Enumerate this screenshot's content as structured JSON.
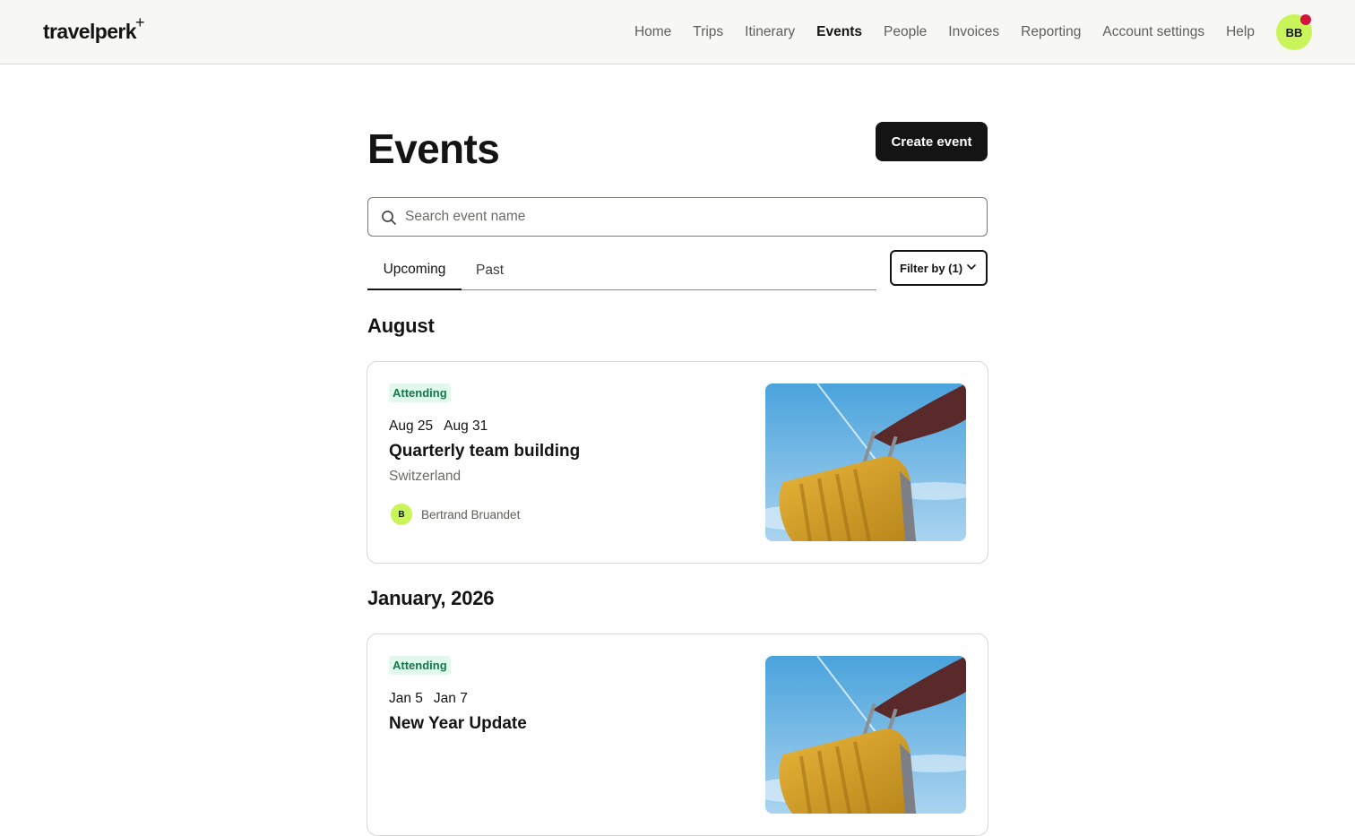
{
  "brand": {
    "logo_text": "travelperk",
    "logo_mark": "+"
  },
  "nav": {
    "items": [
      {
        "label": "Home",
        "active": false
      },
      {
        "label": "Trips",
        "active": false
      },
      {
        "label": "Itinerary",
        "active": false
      },
      {
        "label": "Events",
        "active": true
      },
      {
        "label": "People",
        "active": false
      },
      {
        "label": "Invoices",
        "active": false
      },
      {
        "label": "Reporting",
        "active": false
      },
      {
        "label": "Account settings",
        "active": false
      },
      {
        "label": "Help",
        "active": false
      }
    ],
    "user_initials": "BB",
    "notification_dot": true
  },
  "page": {
    "title": "Events",
    "create_label": "Create event"
  },
  "search": {
    "placeholder": "Search event name",
    "value": "",
    "icon": "search-icon"
  },
  "tabs": [
    {
      "label": "Upcoming",
      "active": true
    },
    {
      "label": "Past",
      "active": false
    }
  ],
  "filter": {
    "label": "Filter by (1)",
    "icon": "chevron-down-icon"
  },
  "groups": [
    {
      "month": "August",
      "event": {
        "status": "Attending",
        "start": "Aug 25",
        "end": "Aug 31",
        "name": "Quarterly team building",
        "location": "Switzerland",
        "organizer_initial": "B",
        "organizer_name": "Bertrand Bruandet"
      }
    },
    {
      "month": "January, 2026",
      "event": {
        "status": "Attending",
        "start": "Jan 5",
        "end": "Jan 7",
        "name": "New Year Update",
        "location": "",
        "organizer_initial": "",
        "organizer_name": ""
      }
    }
  ],
  "colors": {
    "accent_lime": "#c9f55a",
    "badge_bg": "#e2f8ec",
    "badge_text": "#11784a",
    "notification": "#d6133d",
    "primary_button": "#141414"
  }
}
